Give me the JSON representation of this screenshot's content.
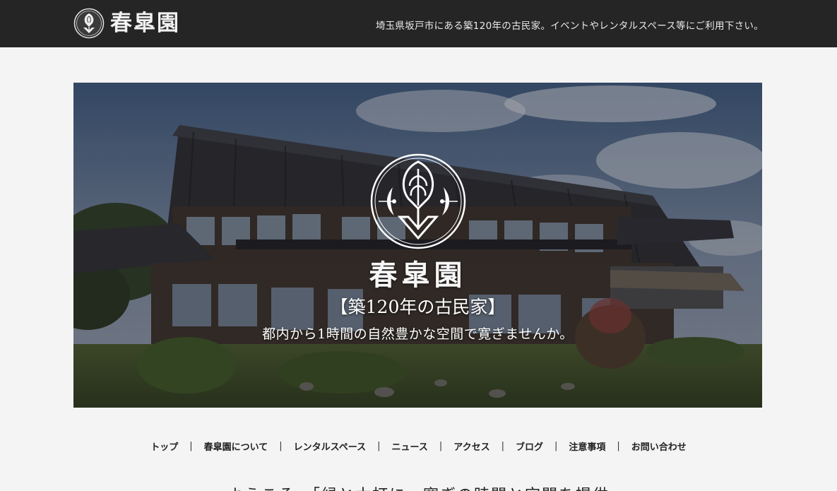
{
  "header": {
    "logo_text": "春皐園",
    "tagline": "埼玉県坂戸市にある築120年の古民家。イベントやレンタルスペース等にご利用下さい。"
  },
  "hero": {
    "name": "春皐園",
    "heading": "【築120年の古民家】",
    "subheading": "都内から1時間の自然豊かな空間で寛ぎませんか。"
  },
  "nav": {
    "items": [
      {
        "label": "トップ",
        "name": "nav-item-top"
      },
      {
        "label": "春皐園について",
        "name": "nav-item-about"
      },
      {
        "label": "レンタルスペース",
        "name": "nav-item-rental-space"
      },
      {
        "label": "ニュース",
        "name": "nav-item-news"
      },
      {
        "label": "アクセス",
        "name": "nav-item-access"
      },
      {
        "label": "ブログ",
        "name": "nav-item-blog"
      },
      {
        "label": "注意事項",
        "name": "nav-item-notes"
      },
      {
        "label": "お問い合わせ",
        "name": "nav-item-contact"
      }
    ]
  },
  "intro": {
    "text": "ようこそ、「緑と木打に」寛ぎの時間と空間を提供"
  },
  "colors": {
    "topbar": "#252525",
    "page_background": "#f4f4f4",
    "hero_text": "#ffffff"
  }
}
